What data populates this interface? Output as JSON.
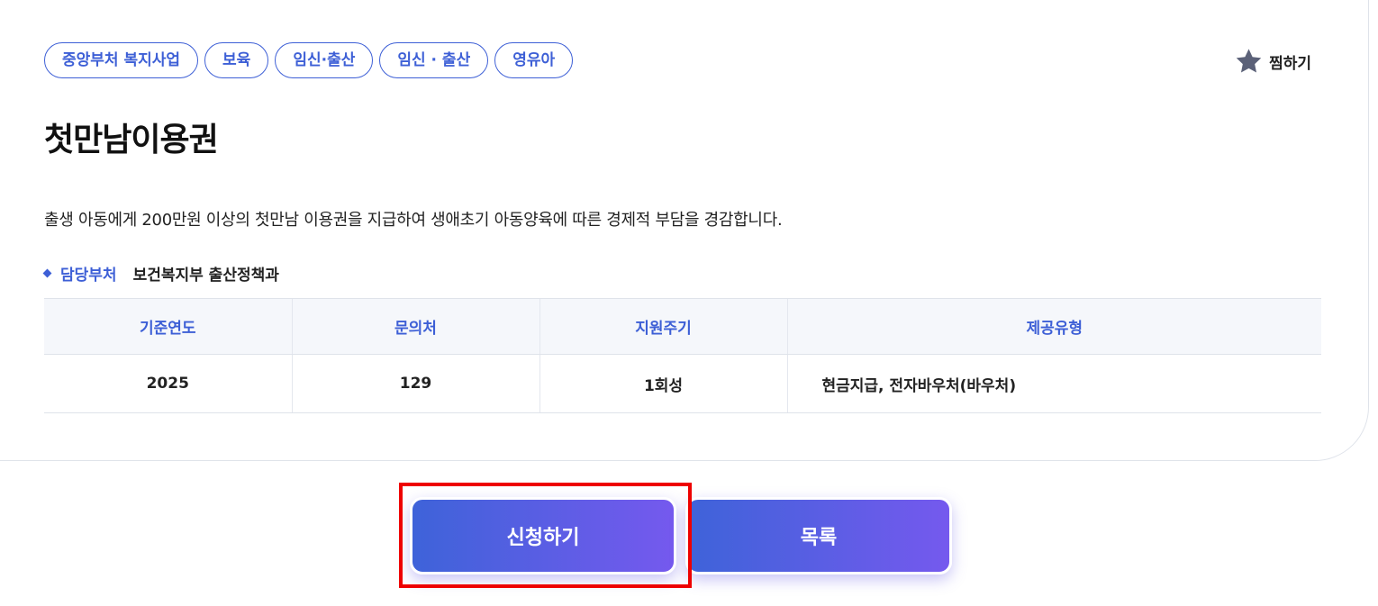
{
  "tags": [
    "중앙부처 복지사업",
    "보육",
    "임신·출산",
    "임신 · 출산",
    "영유아"
  ],
  "favorite": {
    "label": "찜하기",
    "icon": "star-icon"
  },
  "title": "첫만남이용권",
  "description": "출생 아동에게 200만원 이상의 첫만남 이용권을 지급하여 생애초기 아동양육에 따른 경제적 부담을 경감합니다.",
  "department": {
    "label": "담당부처",
    "value": "보건복지부 출산정책과"
  },
  "info_table": {
    "headers": [
      "기준연도",
      "문의처",
      "지원주기",
      "제공유형"
    ],
    "row": [
      "2025",
      "129",
      "1회성",
      "현금지급, 전자바우처(바우처)"
    ]
  },
  "buttons": {
    "apply": "신청하기",
    "list": "목록"
  },
  "colors": {
    "accent": "#3d5fd6",
    "gradient_start": "#3e63d9",
    "gradient_end": "#7559ee",
    "highlight": "#ee0000"
  }
}
